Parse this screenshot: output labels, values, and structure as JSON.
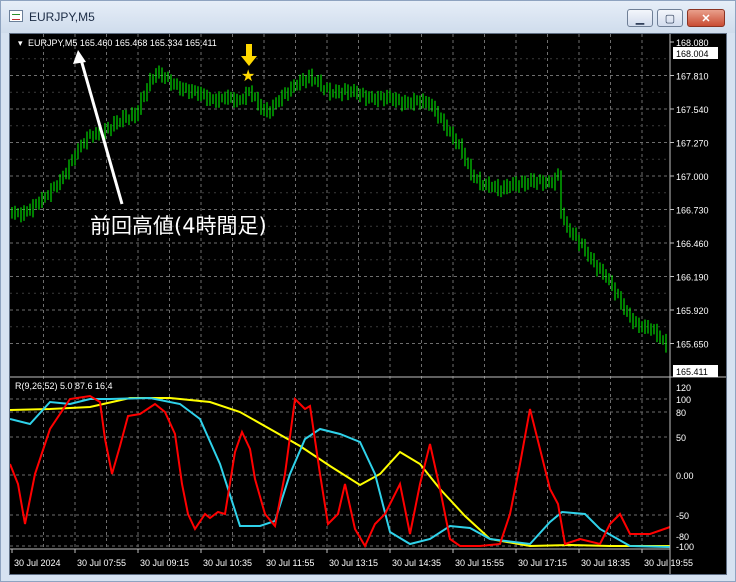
{
  "window": {
    "title": "EURJPY,M5",
    "buttons": {
      "minimize": "▁",
      "maximize": "▢",
      "close": "✕"
    }
  },
  "main_panel": {
    "symbol_info": "EURJPY,M5  165.460 165.468 165.334 165.411",
    "price_ticks": [
      "168.080",
      "167.810",
      "167.540",
      "167.270",
      "167.000",
      "166.730",
      "166.460",
      "166.190",
      "165.920",
      "165.650"
    ],
    "current_high_label": "168.004",
    "current_price_label": "165.411",
    "annotation_text": "前回高値(4時間足)",
    "annotation_color": "#ffffff",
    "marker_arrow_color": "#ffd800",
    "marker_star_color": "#ffd800"
  },
  "indicator_panel": {
    "label": "R(9,26,52) 5.0 87.6 16.4",
    "ticks": [
      "120",
      "100",
      "80",
      "50",
      "0.00",
      "-50",
      "-80",
      "-100"
    ]
  },
  "time_axis": {
    "labels": [
      "30 Jul 2024",
      "30 Jul 07:55",
      "30 Jul 09:15",
      "30 Jul 10:35",
      "30 Jul 11:55",
      "30 Jul 13:15",
      "30 Jul 14:35",
      "30 Jul 15:55",
      "30 Jul 17:15",
      "30 Jul 18:35",
      "30 Jul 19:55"
    ]
  },
  "colors": {
    "candle": "#00ff00",
    "grid": "#6e6e6e",
    "red_line": "#ff0000",
    "cyan_line": "#2fd2ea",
    "yellow_line": "#ffff00",
    "axis_text": "#ffffff"
  }
}
